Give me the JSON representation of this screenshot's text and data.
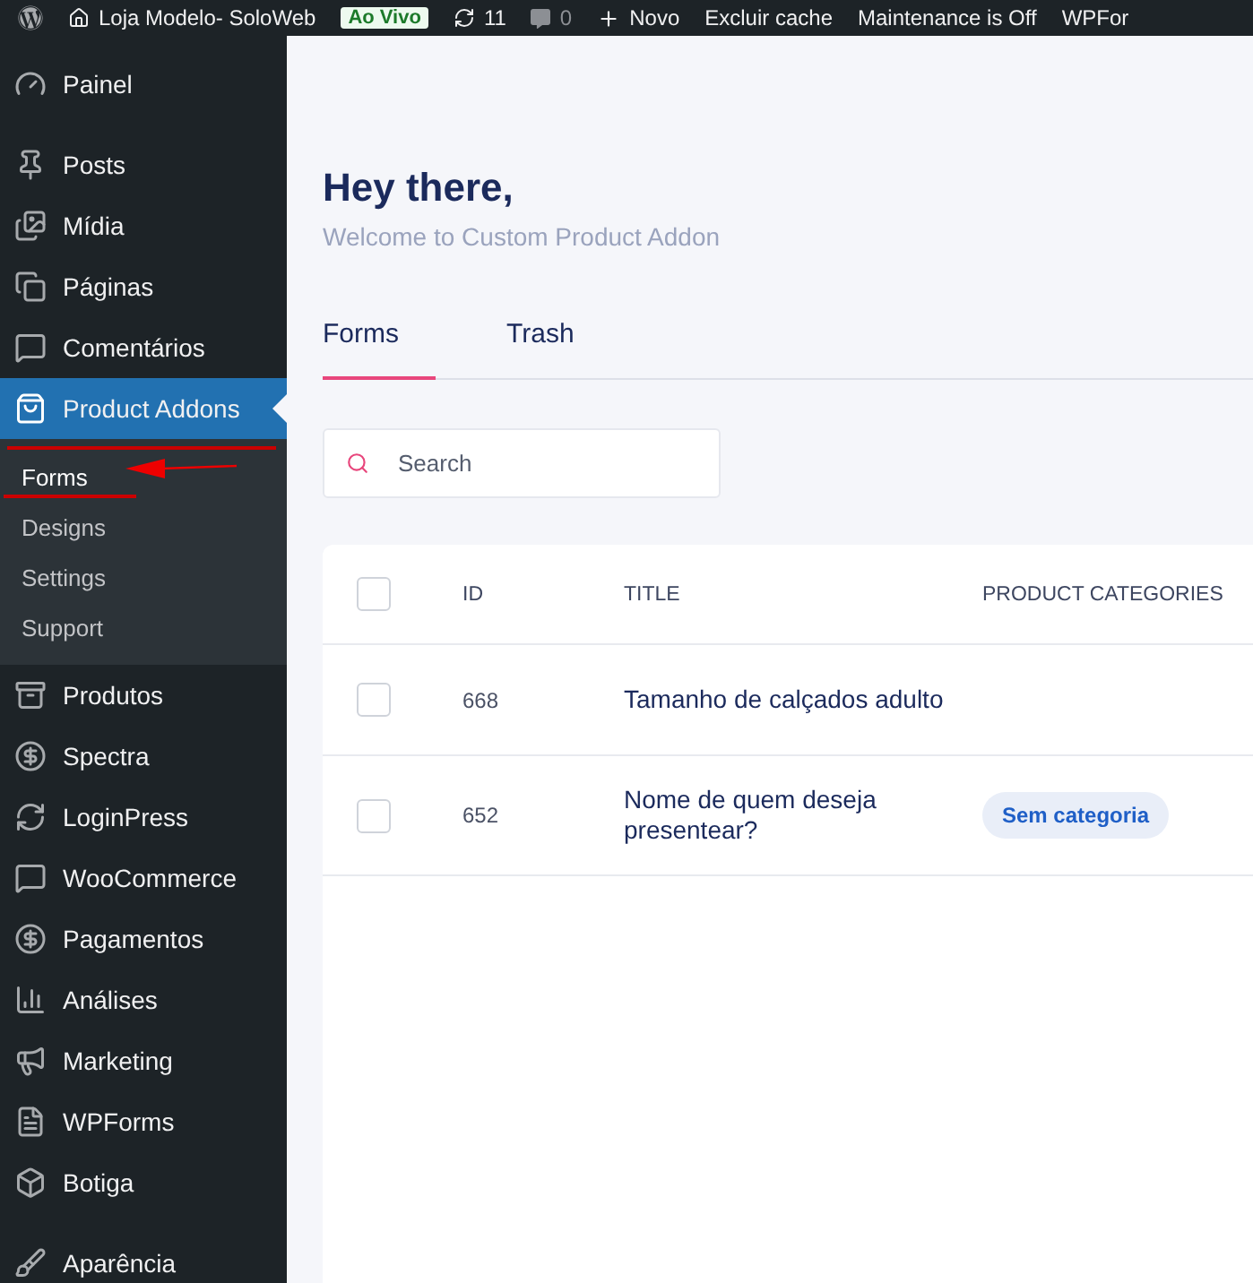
{
  "admin_bar": {
    "site_name": "Loja Modelo- SoloWeb",
    "live_badge": "Ao Vivo",
    "updates": "11",
    "comments": "0",
    "new": "Novo",
    "items": [
      "Excluir cache",
      "Maintenance is Off",
      "WPFor"
    ]
  },
  "sidebar": {
    "items": [
      {
        "label": "Painel",
        "selected": false
      },
      {
        "label": "Posts",
        "selected": false
      },
      {
        "label": "Mídia",
        "selected": false
      },
      {
        "label": "Páginas",
        "selected": false
      },
      {
        "label": "Comentários",
        "selected": false
      },
      {
        "label": "Product Addons",
        "selected": true,
        "children": [
          {
            "label": "Forms",
            "selected": true
          },
          {
            "label": "Designs",
            "selected": false
          },
          {
            "label": "Settings",
            "selected": false
          },
          {
            "label": "Support",
            "selected": false
          }
        ]
      },
      {
        "label": "Produtos",
        "selected": false
      },
      {
        "label": "Spectra",
        "selected": false
      },
      {
        "label": "LoginPress",
        "selected": false
      },
      {
        "label": "WooCommerce",
        "selected": false
      },
      {
        "label": "Pagamentos",
        "selected": false
      },
      {
        "label": "Análises",
        "selected": false
      },
      {
        "label": "Marketing",
        "selected": false
      },
      {
        "label": "WPForms",
        "selected": false
      },
      {
        "label": "Botiga",
        "selected": false
      },
      {
        "label": "Aparência",
        "selected": false
      }
    ]
  },
  "header": {
    "title": "Hey there,",
    "subtitle": "Welcome to Custom Product Addon"
  },
  "tabs": [
    {
      "label": "Forms",
      "selected": true
    },
    {
      "label": "Trash",
      "selected": false
    }
  ],
  "search": {
    "placeholder": "Search"
  },
  "table": {
    "columns": [
      "ID",
      "TITLE",
      "PRODUCT CATEGORIES"
    ],
    "select_all_checked": false,
    "rows": [
      {
        "checked": false,
        "id": "668",
        "title": "Tamanho de calçados adulto",
        "categories": []
      },
      {
        "checked": false,
        "id": "652",
        "title": "Nome de quem deseja presentear?",
        "categories": [
          "Sem categoria"
        ]
      }
    ]
  }
}
